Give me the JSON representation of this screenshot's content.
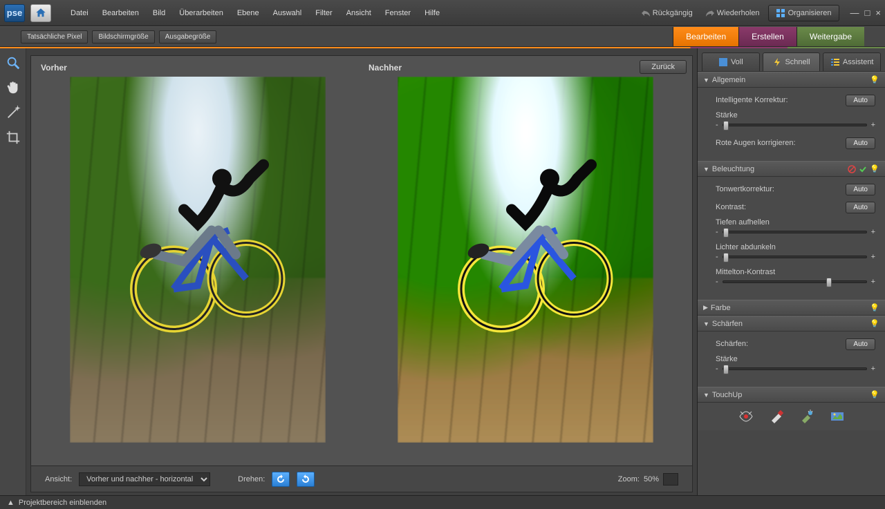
{
  "app": {
    "logo": "pse"
  },
  "menu": [
    "Datei",
    "Bearbeiten",
    "Bild",
    "Überarbeiten",
    "Ebene",
    "Auswahl",
    "Filter",
    "Ansicht",
    "Fenster",
    "Hilfe"
  ],
  "history": {
    "undo": "Rückgängig",
    "redo": "Wiederholen"
  },
  "organize": "Organisieren",
  "options": [
    "Tatsächliche Pixel",
    "Bildschirmgröße",
    "Ausgabegröße"
  ],
  "modes": {
    "edit": "Bearbeiten",
    "create": "Erstellen",
    "share": "Weitergabe"
  },
  "compare": {
    "before": "Vorher",
    "after": "Nachher",
    "back": "Zurück"
  },
  "footer": {
    "view_label": "Ansicht:",
    "view_value": "Vorher und nachher - horizontal",
    "rotate_label": "Drehen:",
    "zoom_label": "Zoom:",
    "zoom_value": "50%"
  },
  "status": "Projektbereich einblenden",
  "view_tabs": {
    "full": "Voll",
    "quick": "Schnell",
    "guided": "Assistent"
  },
  "panel": {
    "general": {
      "title": "Allgemein",
      "smartfix": "Intelligente Korrektur:",
      "amount": "Stärke",
      "redeye": "Rote Augen korrigieren:"
    },
    "lighting": {
      "title": "Beleuchtung",
      "levels": "Tonwertkorrektur:",
      "contrast": "Kontrast:",
      "shadows": "Tiefen aufhellen",
      "highlights": "Lichter abdunkeln",
      "midtone": "Mittelton-Kontrast"
    },
    "color": {
      "title": "Farbe"
    },
    "sharpen": {
      "title": "Schärfen",
      "label": "Schärfen:",
      "amount": "Stärke"
    },
    "touchup": {
      "title": "TouchUp"
    },
    "auto": "Auto"
  }
}
